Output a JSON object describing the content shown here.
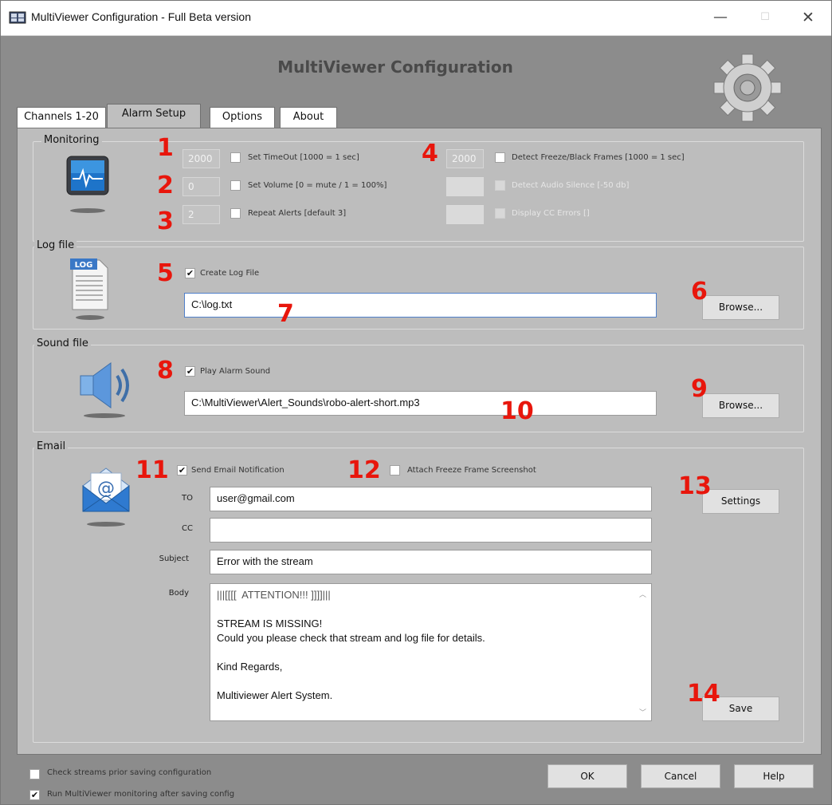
{
  "window": {
    "title": "MultiViewer Configuration - Full Beta version",
    "minimize_glyph": "—",
    "maximize_glyph": "☐",
    "close_glyph": "✕"
  },
  "header": {
    "title": "MultiViewer Configuration"
  },
  "tabs": [
    {
      "label": "Channels 1-20",
      "active": false
    },
    {
      "label": "Alarm Setup",
      "active": true
    },
    {
      "label": "Options",
      "active": false
    },
    {
      "label": "About",
      "active": false
    }
  ],
  "monitoring": {
    "legend": "Monitoring",
    "timeout": {
      "value": "2000",
      "label": "Set TimeOut [1000 = 1 sec]",
      "checked": false
    },
    "volume": {
      "value": "0",
      "label": "Set Volume [0 = mute / 1 = 100%]",
      "checked": false
    },
    "repeat": {
      "value": "2",
      "label": "Repeat Alerts [default 3]",
      "checked": false
    },
    "freeze": {
      "value": "2000",
      "label": "Detect Freeze/Black Frames [1000 = 1 sec]",
      "checked": false
    },
    "silence": {
      "value": "",
      "label": "Detect Audio Silence [-50 db]",
      "checked": false,
      "disabled": true
    },
    "cc_errors": {
      "value": "",
      "label": "Display CC Errors []",
      "checked": false,
      "disabled": true
    }
  },
  "logfile": {
    "legend": "Log file",
    "icon_text": "LOG",
    "create_label": "Create Log File",
    "create_checked": true,
    "path": "C:\\log.txt",
    "browse_label": "Browse..."
  },
  "soundfile": {
    "legend": "Sound file",
    "play_label": "Play Alarm Sound",
    "play_checked": true,
    "path": "C:\\MultiViewer\\Alert_Sounds\\robo-alert-short.mp3",
    "browse_label": "Browse..."
  },
  "email": {
    "legend": "Email",
    "send_label": "Send Email Notification",
    "send_checked": true,
    "attach_label": "Attach Freeze Frame Screenshot",
    "attach_checked": false,
    "to_label": "TO",
    "to_value": "user@gmail.com",
    "cc_label": "CC",
    "cc_value": "",
    "subject_label": "Subject",
    "subject_value": "Error with the stream",
    "body_label": "Body",
    "body_lines": [
      "|||[[[[  ATTENTION!!! ]]]]|||",
      "",
      "STREAM IS MISSING!",
      "Could you please check that stream and log file for details.",
      "",
      "Kind Regards,",
      "",
      "Multiviewer Alert System."
    ],
    "settings_label": "Settings",
    "save_label": "Save"
  },
  "footer": {
    "check_streams_label": "Check streams prior saving configuration",
    "check_streams_checked": false,
    "run_monitoring_label": "Run MultiViewer monitoring after saving config",
    "run_monitoring_checked": true,
    "ok_label": "OK",
    "cancel_label": "Cancel",
    "help_label": "Help"
  },
  "annotations": [
    "1",
    "2",
    "3",
    "4",
    "5",
    "6",
    "7",
    "8",
    "9",
    "10",
    "11",
    "12",
    "13",
    "14"
  ],
  "colors": {
    "annotation_red": "#e8160c",
    "panel": "#bdbdbd",
    "window_bg": "#8c8c8c"
  }
}
